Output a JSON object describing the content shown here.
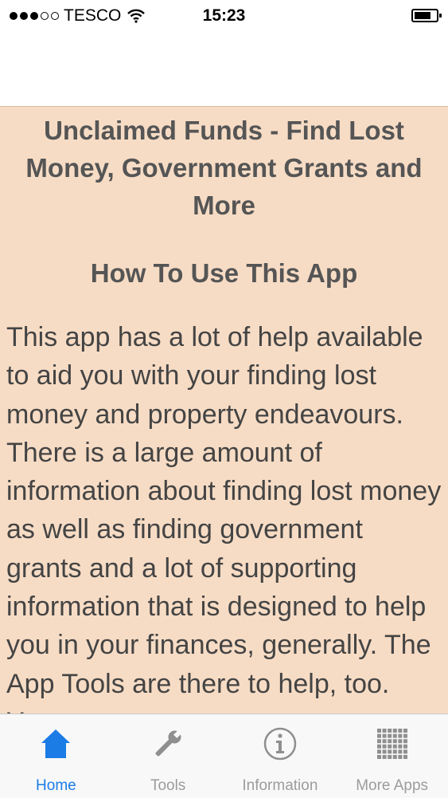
{
  "status_bar": {
    "carrier": "TESCO",
    "time": "15:23",
    "signal_bars": 3,
    "signal_total": 5,
    "battery_level": 0.75
  },
  "content": {
    "title": "Unclaimed Funds - Find Lost Money, Government Grants and More",
    "subtitle": "How To Use This App",
    "body": "This app has a lot of help available to aid you with your finding lost money and property endeavours. There is a large amount of information about finding lost money as well as finding government grants and a lot of supporting information that is designed to help you in your finances, generally. The App Tools are there to help, too. You",
    "background_color": "#f7dcc5"
  },
  "tab_bar": {
    "active_color": "#1b7ce6",
    "inactive_color": "#9c9c9c",
    "tabs": [
      {
        "label": "Home",
        "icon": "home-icon",
        "active": true
      },
      {
        "label": "Tools",
        "icon": "wrench-icon",
        "active": false
      },
      {
        "label": "Information",
        "icon": "info-icon",
        "active": false
      },
      {
        "label": "More Apps",
        "icon": "grid-icon",
        "active": false
      }
    ]
  }
}
